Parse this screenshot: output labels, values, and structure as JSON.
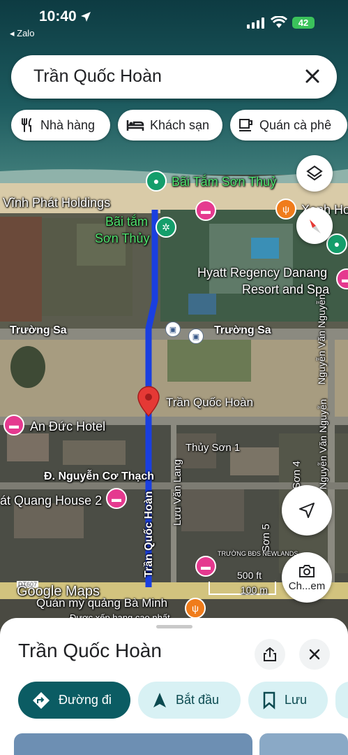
{
  "status_bar": {
    "time": "10:40",
    "back_app": "◂ Zalo",
    "battery": "42"
  },
  "search": {
    "query": "Trần Quốc Hoàn"
  },
  "chips": [
    {
      "label": "Nhà hàng",
      "icon": "restaurant-icon"
    },
    {
      "label": "Khách sạn",
      "icon": "hotel-icon"
    },
    {
      "label": "Quán cà phê",
      "icon": "coffee-icon"
    }
  ],
  "map": {
    "labels": {
      "beach_top": "Bãi Tắm Sơn Thuỷ",
      "vinh_phat": "Vĩnh Phát Holdings",
      "xanh_ho": "Xanh Ho",
      "bai_tam_1": "Bãi tắm",
      "bai_tam_2": "Sơn Thủy",
      "hyatt_1": "Hyatt Regency Danang",
      "hyatt_2": "Resort and Spa",
      "truong_sa_left": "Trường Sa",
      "truong_sa_right": "Trường Sa",
      "nguyen_van_nguyen_1": "Nguyễn Văn Nguyễn",
      "nguyen_van_nguyen_2": "Nguyễn Văn Nguyễn",
      "pin_label": "Trần Quốc Hoàn",
      "an_duc": "An Đức Hotel",
      "thuy_son_1": "Thủy Sơn 1",
      "nguyen_co_thach": "Đ. Nguyễn Cơ Thạch",
      "quang_house": "át Quang House 2",
      "luu_van_lang": "Lưu Văn Lang",
      "tran_quoc_hoan_vertical": "Trần Quốc Hoàn",
      "son_4": "Sơn 4",
      "son_5": "Sơn 5",
      "truong_bds": "TRƯỜNG BĐS NEWLANDS",
      "mi_quang": "Quán mỳ quảng Bà Minh",
      "duoc_xep": "Được xếp hạng cao nhất",
      "road_607": "DT607",
      "nguyen_van_vertical": "Nguyễn Văn"
    },
    "scale": {
      "feet": "500 ft",
      "meters": "100 m"
    },
    "watermark": "Google Maps",
    "camera_label": "Ch...em"
  },
  "sheet": {
    "title": "Trần Quốc Hoàn",
    "actions": [
      {
        "label": "Đường đi",
        "icon": "directions-icon"
      },
      {
        "label": "Bắt đầu",
        "icon": "navigation-icon"
      },
      {
        "label": "Lưu",
        "icon": "bookmark-icon"
      }
    ]
  },
  "colors": {
    "route": "#1a3fe0",
    "primary_action": "#0b5c63",
    "secondary_action_bg": "#d8f1f4",
    "pin": "#e53935"
  }
}
